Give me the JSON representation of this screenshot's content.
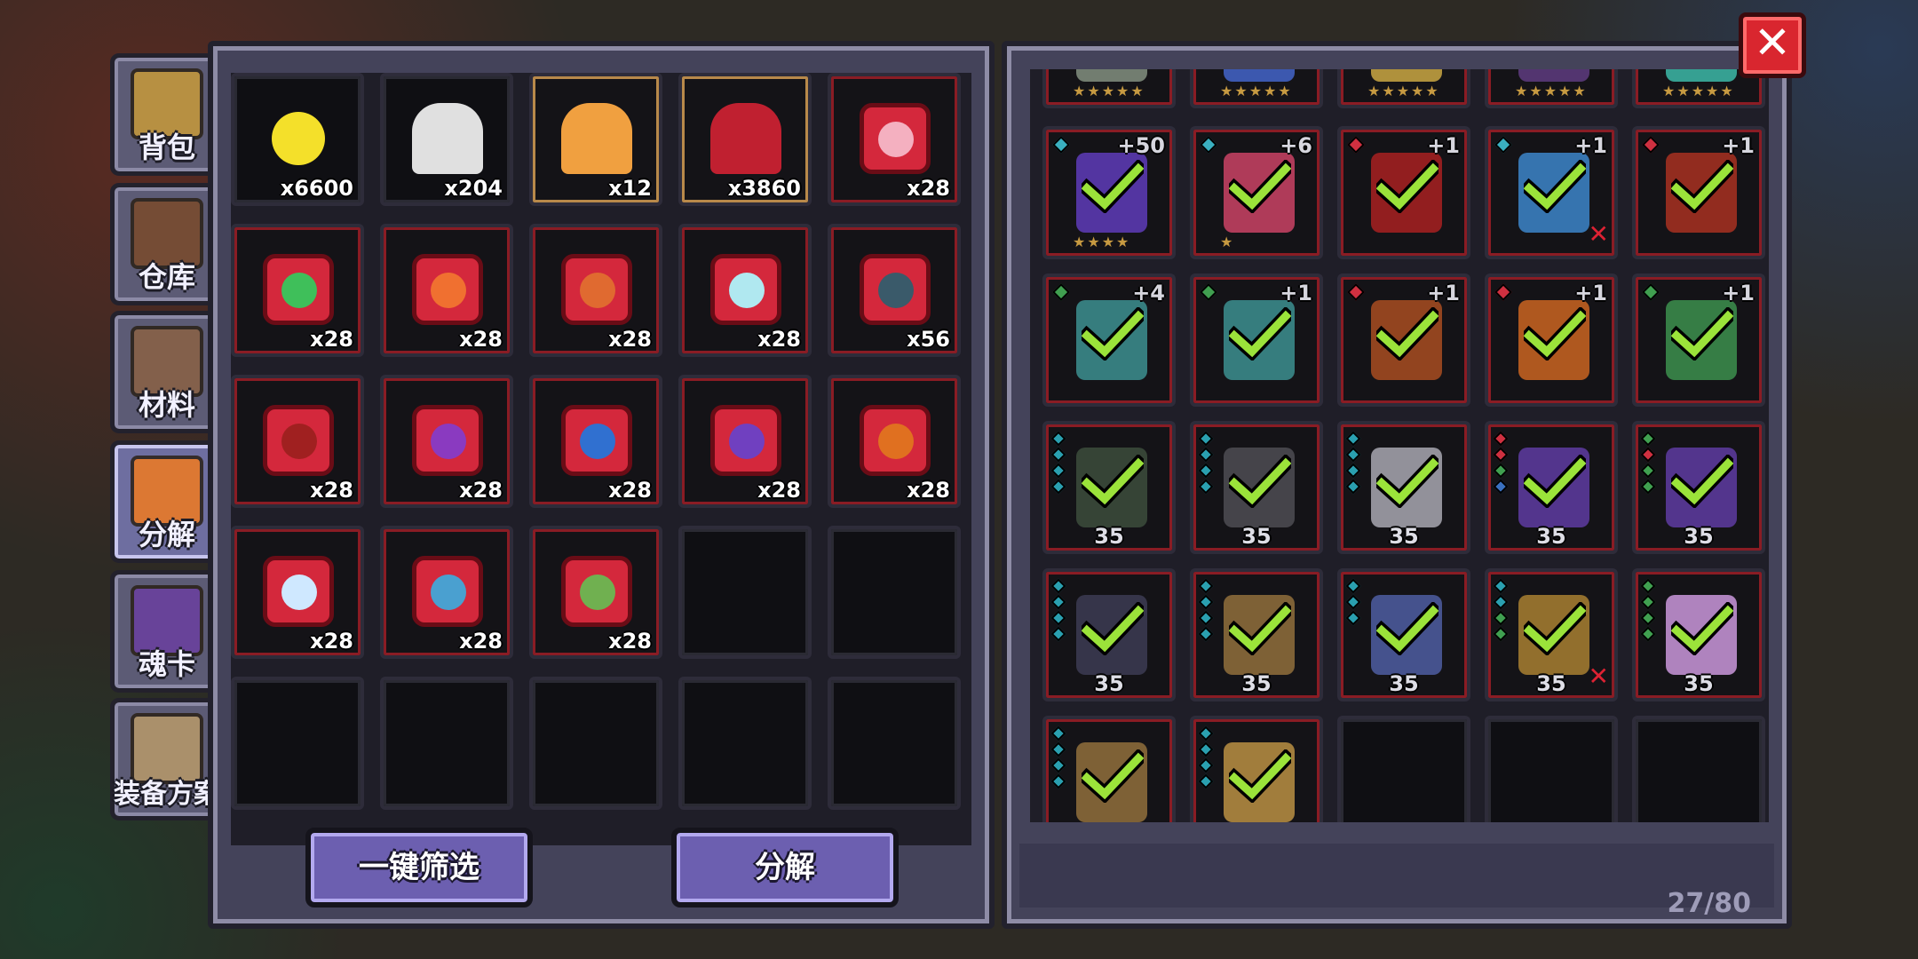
{
  "tabs": [
    {
      "label": "背包",
      "icon": "chest-icon",
      "color": "#c89a3a"
    },
    {
      "label": "仓库",
      "icon": "storage-chest-icon",
      "color": "#7a4a2a"
    },
    {
      "label": "材料",
      "icon": "material-crate-icon",
      "color": "#8a6244"
    },
    {
      "label": "分解",
      "icon": "salvage-cauldron-icon",
      "color": "#f07a20"
    },
    {
      "label": "魂卡",
      "icon": "soul-card-icon",
      "color": "#6b3fa0"
    },
    {
      "label": "装备方案",
      "icon": "armor-loadout-icon",
      "color": "#b89a6a"
    }
  ],
  "materials": [
    {
      "name": "gold-coin-icon",
      "qty": "x6600",
      "color": "#f4e02a",
      "frame": "normal",
      "badge": false
    },
    {
      "name": "silver-dust-icon",
      "qty": "x204",
      "color": "#e0e0e0",
      "frame": "normal",
      "badge": false
    },
    {
      "name": "orange-dust-icon",
      "qty": "x12",
      "color": "#f0a040",
      "frame": "gold",
      "badge": false
    },
    {
      "name": "red-crystal-icon",
      "qty": "x3860",
      "color": "#c02030",
      "frame": "gold",
      "badge": false
    },
    {
      "name": "axe-essence-icon",
      "qty": "x28",
      "color": "#f4b0c0",
      "frame": "red",
      "badge": true
    },
    {
      "name": "green-wand-essence-icon",
      "qty": "x28",
      "color": "#3fbf5a",
      "frame": "red",
      "badge": true
    },
    {
      "name": "flame-helm-essence-icon",
      "qty": "x28",
      "color": "#f07030",
      "frame": "red",
      "badge": true
    },
    {
      "name": "rune-essence-icon",
      "qty": "x28",
      "color": "#e06a30",
      "frame": "red",
      "badge": true
    },
    {
      "name": "ice-hammer-essence-icon",
      "qty": "x28",
      "color": "#b0e8f0",
      "frame": "red",
      "badge": true
    },
    {
      "name": "dark-blade-essence-icon",
      "qty": "x56",
      "color": "#3a5a6a",
      "frame": "red",
      "badge": true
    },
    {
      "name": "fire-sword-essence-icon",
      "qty": "x28",
      "color": "#a02020",
      "frame": "red",
      "badge": true
    },
    {
      "name": "purple-bow-essence-icon",
      "qty": "x28",
      "color": "#8a3ac0",
      "frame": "red",
      "badge": true
    },
    {
      "name": "blue-blade-essence-icon",
      "qty": "x28",
      "color": "#3070d0",
      "frame": "red",
      "badge": true
    },
    {
      "name": "violet-crossbow-essence-icon",
      "qty": "x28",
      "color": "#7040c0",
      "frame": "red",
      "badge": true
    },
    {
      "name": "flame-torch-essence-icon",
      "qty": "x28",
      "color": "#e07020",
      "frame": "red",
      "badge": true
    },
    {
      "name": "frost-orb-essence-icon",
      "qty": "x28",
      "color": "#cfe8ff",
      "frame": "red",
      "badge": true
    },
    {
      "name": "frost-bow-essence-icon",
      "qty": "x28",
      "color": "#4aa0d0",
      "frame": "red",
      "badge": true
    },
    {
      "name": "leaf-glove-essence-icon",
      "qty": "x28",
      "color": "#70b050",
      "frame": "red",
      "badge": true
    }
  ],
  "buttons": {
    "filter": "一键筛选",
    "salvage": "分解"
  },
  "equipment": [
    {
      "row": 0,
      "col": 0,
      "type": "cloak",
      "color": "#7c8a7a",
      "plus": "",
      "level": "",
      "stars": 5,
      "checked": true,
      "gem": "",
      "x": false
    },
    {
      "row": 0,
      "col": 1,
      "type": "staff",
      "color": "#4060c0",
      "plus": "",
      "level": "",
      "stars": 5,
      "checked": true,
      "gem": "",
      "x": false
    },
    {
      "row": 0,
      "col": 2,
      "type": "amulet",
      "color": "#c0a040",
      "plus": "",
      "level": "",
      "stars": 5,
      "checked": true,
      "gem": "",
      "x": false
    },
    {
      "row": 0,
      "col": 3,
      "type": "wings",
      "color": "#5a3a7a",
      "plus": "",
      "level": "",
      "stars": 5,
      "checked": true,
      "gem": "",
      "x": false
    },
    {
      "row": 0,
      "col": 4,
      "type": "totem",
      "color": "#3ab0a0",
      "plus": "",
      "level": "",
      "stars": 5,
      "checked": true,
      "gem": "",
      "x": false
    },
    {
      "row": 1,
      "col": 0,
      "type": "bow",
      "color": "#5a3ab0",
      "plus": "+50",
      "level": "",
      "stars": 4,
      "checked": true,
      "gem": "#3ab0c0",
      "x": false
    },
    {
      "row": 1,
      "col": 1,
      "type": "axe",
      "color": "#c04060",
      "plus": "+6",
      "level": "",
      "stars": 1,
      "checked": true,
      "gem": "#3ab0c0",
      "x": false
    },
    {
      "row": 1,
      "col": 2,
      "type": "sword",
      "color": "#a02020",
      "plus": "+1",
      "level": "",
      "stars": 0,
      "checked": true,
      "gem": "#d03040",
      "x": false
    },
    {
      "row": 1,
      "col": 3,
      "type": "blade",
      "color": "#3a80c0",
      "plus": "+1",
      "level": "",
      "stars": 0,
      "checked": true,
      "gem": "#3ab0c0",
      "x": true
    },
    {
      "row": 1,
      "col": 4,
      "type": "dagger",
      "color": "#a03020",
      "plus": "+1",
      "level": "",
      "stars": 0,
      "checked": true,
      "gem": "#d03040",
      "x": false
    },
    {
      "row": 2,
      "col": 0,
      "type": "crossbow",
      "color": "#3a8a8a",
      "plus": "+4",
      "level": "",
      "stars": 0,
      "checked": true,
      "gem": "#40a050",
      "x": false
    },
    {
      "row": 2,
      "col": 1,
      "type": "crossbow",
      "color": "#3a8a8a",
      "plus": "+1",
      "level": "",
      "stars": 0,
      "checked": true,
      "gem": "#40a050",
      "x": false
    },
    {
      "row": 2,
      "col": 2,
      "type": "rope",
      "color": "#a04a20",
      "plus": "+1",
      "level": "",
      "stars": 0,
      "checked": true,
      "gem": "#d03040",
      "x": false
    },
    {
      "row": 2,
      "col": 3,
      "type": "idol",
      "color": "#c06020",
      "plus": "+1",
      "level": "",
      "stars": 0,
      "checked": true,
      "gem": "#d03040",
      "x": false
    },
    {
      "row": 2,
      "col": 4,
      "type": "mace",
      "color": "#3a8a4a",
      "plus": "+1",
      "level": "",
      "stars": 0,
      "checked": true,
      "gem": "#40a050",
      "x": false
    },
    {
      "row": 3,
      "col": 0,
      "type": "armor",
      "color": "#3a4a3a",
      "plus": "",
      "level": "35",
      "stars": 0,
      "checked": true,
      "gemCol": [
        "#2aa0b0",
        "#2aa0b0",
        "#2aa0b0",
        "#2aa0b0"
      ],
      "x": false
    },
    {
      "row": 3,
      "col": 1,
      "type": "helm",
      "color": "#4a4a50",
      "plus": "",
      "level": "35",
      "stars": 0,
      "checked": true,
      "gemCol": [
        "#2aa0b0",
        "#2aa0b0",
        "#2aa0b0",
        "#2aa0b0"
      ],
      "x": false
    },
    {
      "row": 3,
      "col": 2,
      "type": "hat",
      "color": "#a0a0a8",
      "plus": "",
      "level": "35",
      "stars": 0,
      "checked": true,
      "gemCol": [
        "#2aa0b0",
        "#2aa0b0",
        "#2aa0b0",
        "#2aa0b0"
      ],
      "x": false
    },
    {
      "row": 3,
      "col": 3,
      "type": "robe",
      "color": "#5a3a9a",
      "plus": "",
      "level": "35",
      "stars": 0,
      "checked": true,
      "gemCol": [
        "#d03040",
        "#d03040",
        "#40a050",
        "#3a70c0"
      ],
      "x": false
    },
    {
      "row": 3,
      "col": 4,
      "type": "robe",
      "color": "#5a3a9a",
      "plus": "",
      "level": "35",
      "stars": 0,
      "checked": true,
      "gemCol": [
        "#40a050",
        "#d03040",
        "#40a050",
        "#40a050"
      ],
      "x": false
    },
    {
      "row": 4,
      "col": 0,
      "type": "armor",
      "color": "#3a3a50",
      "plus": "",
      "level": "35",
      "stars": 0,
      "checked": true,
      "gemCol": [
        "#2aa0b0",
        "#2aa0b0",
        "#2aa0b0",
        "#2aa0b0"
      ],
      "x": false
    },
    {
      "row": 4,
      "col": 1,
      "type": "necklace",
      "color": "#8a6a3a",
      "plus": "",
      "level": "35",
      "stars": 0,
      "checked": true,
      "gemCol": [
        "#2aa0b0",
        "#2aa0b0",
        "#2aa0b0",
        "#2aa0b0"
      ],
      "x": false
    },
    {
      "row": 4,
      "col": 2,
      "type": "bowstring",
      "color": "#4a5a9a",
      "plus": "",
      "level": "35",
      "stars": 0,
      "checked": true,
      "gemCol": [
        "#2aa0b0",
        "#2aa0b0",
        "#2aa0b0"
      ],
      "x": false
    },
    {
      "row": 4,
      "col": 3,
      "type": "necklace",
      "color": "#a07a30",
      "plus": "",
      "level": "35",
      "stars": 0,
      "checked": true,
      "gemCol": [
        "#2aa0b0",
        "#2aa0b0",
        "#40a050",
        "#40a050"
      ],
      "x": true
    },
    {
      "row": 4,
      "col": 4,
      "type": "pendant",
      "color": "#c090d0",
      "plus": "",
      "level": "35",
      "stars": 0,
      "checked": true,
      "gemCol": [
        "#40a050",
        "#40a050",
        "#40a050",
        "#40a050"
      ],
      "x": false
    },
    {
      "row": 5,
      "col": 0,
      "type": "boots",
      "color": "#8a6a3a",
      "plus": "",
      "level": "",
      "stars": 0,
      "checked": true,
      "gemCol": [
        "#2aa0b0",
        "#2aa0b0",
        "#2aa0b0",
        "#2aa0b0"
      ],
      "x": false
    },
    {
      "row": 5,
      "col": 1,
      "type": "gauntlet",
      "color": "#b08a40",
      "plus": "",
      "level": "",
      "stars": 0,
      "checked": true,
      "gemCol": [
        "#2aa0b0",
        "#2aa0b0",
        "#2aa0b0",
        "#2aa0b0"
      ],
      "x": false
    }
  ],
  "capacity": "27/80",
  "close_icon": "close-icon"
}
